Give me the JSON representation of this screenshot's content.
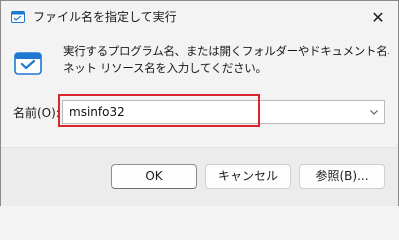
{
  "window": {
    "title": "ファイル名を指定して実行",
    "close_symbol": "✕"
  },
  "description": {
    "line1": "実行するプログラム名、または開くフォルダーやドキュメント名、インター",
    "line2": "ネット リソース名を入力してください。"
  },
  "name_field": {
    "label": "名前(O):",
    "value": "msinfo32"
  },
  "buttons": {
    "ok": "OK",
    "cancel": "キャンセル",
    "browse": "参照(B)..."
  },
  "colors": {
    "highlight": "#d8262a",
    "icon_blue": "#1e78d2"
  },
  "icons": {
    "app": "run-app-icon",
    "run": "run-dialog-icon",
    "dropdown": "chevron-down-icon",
    "close": "close-icon"
  }
}
